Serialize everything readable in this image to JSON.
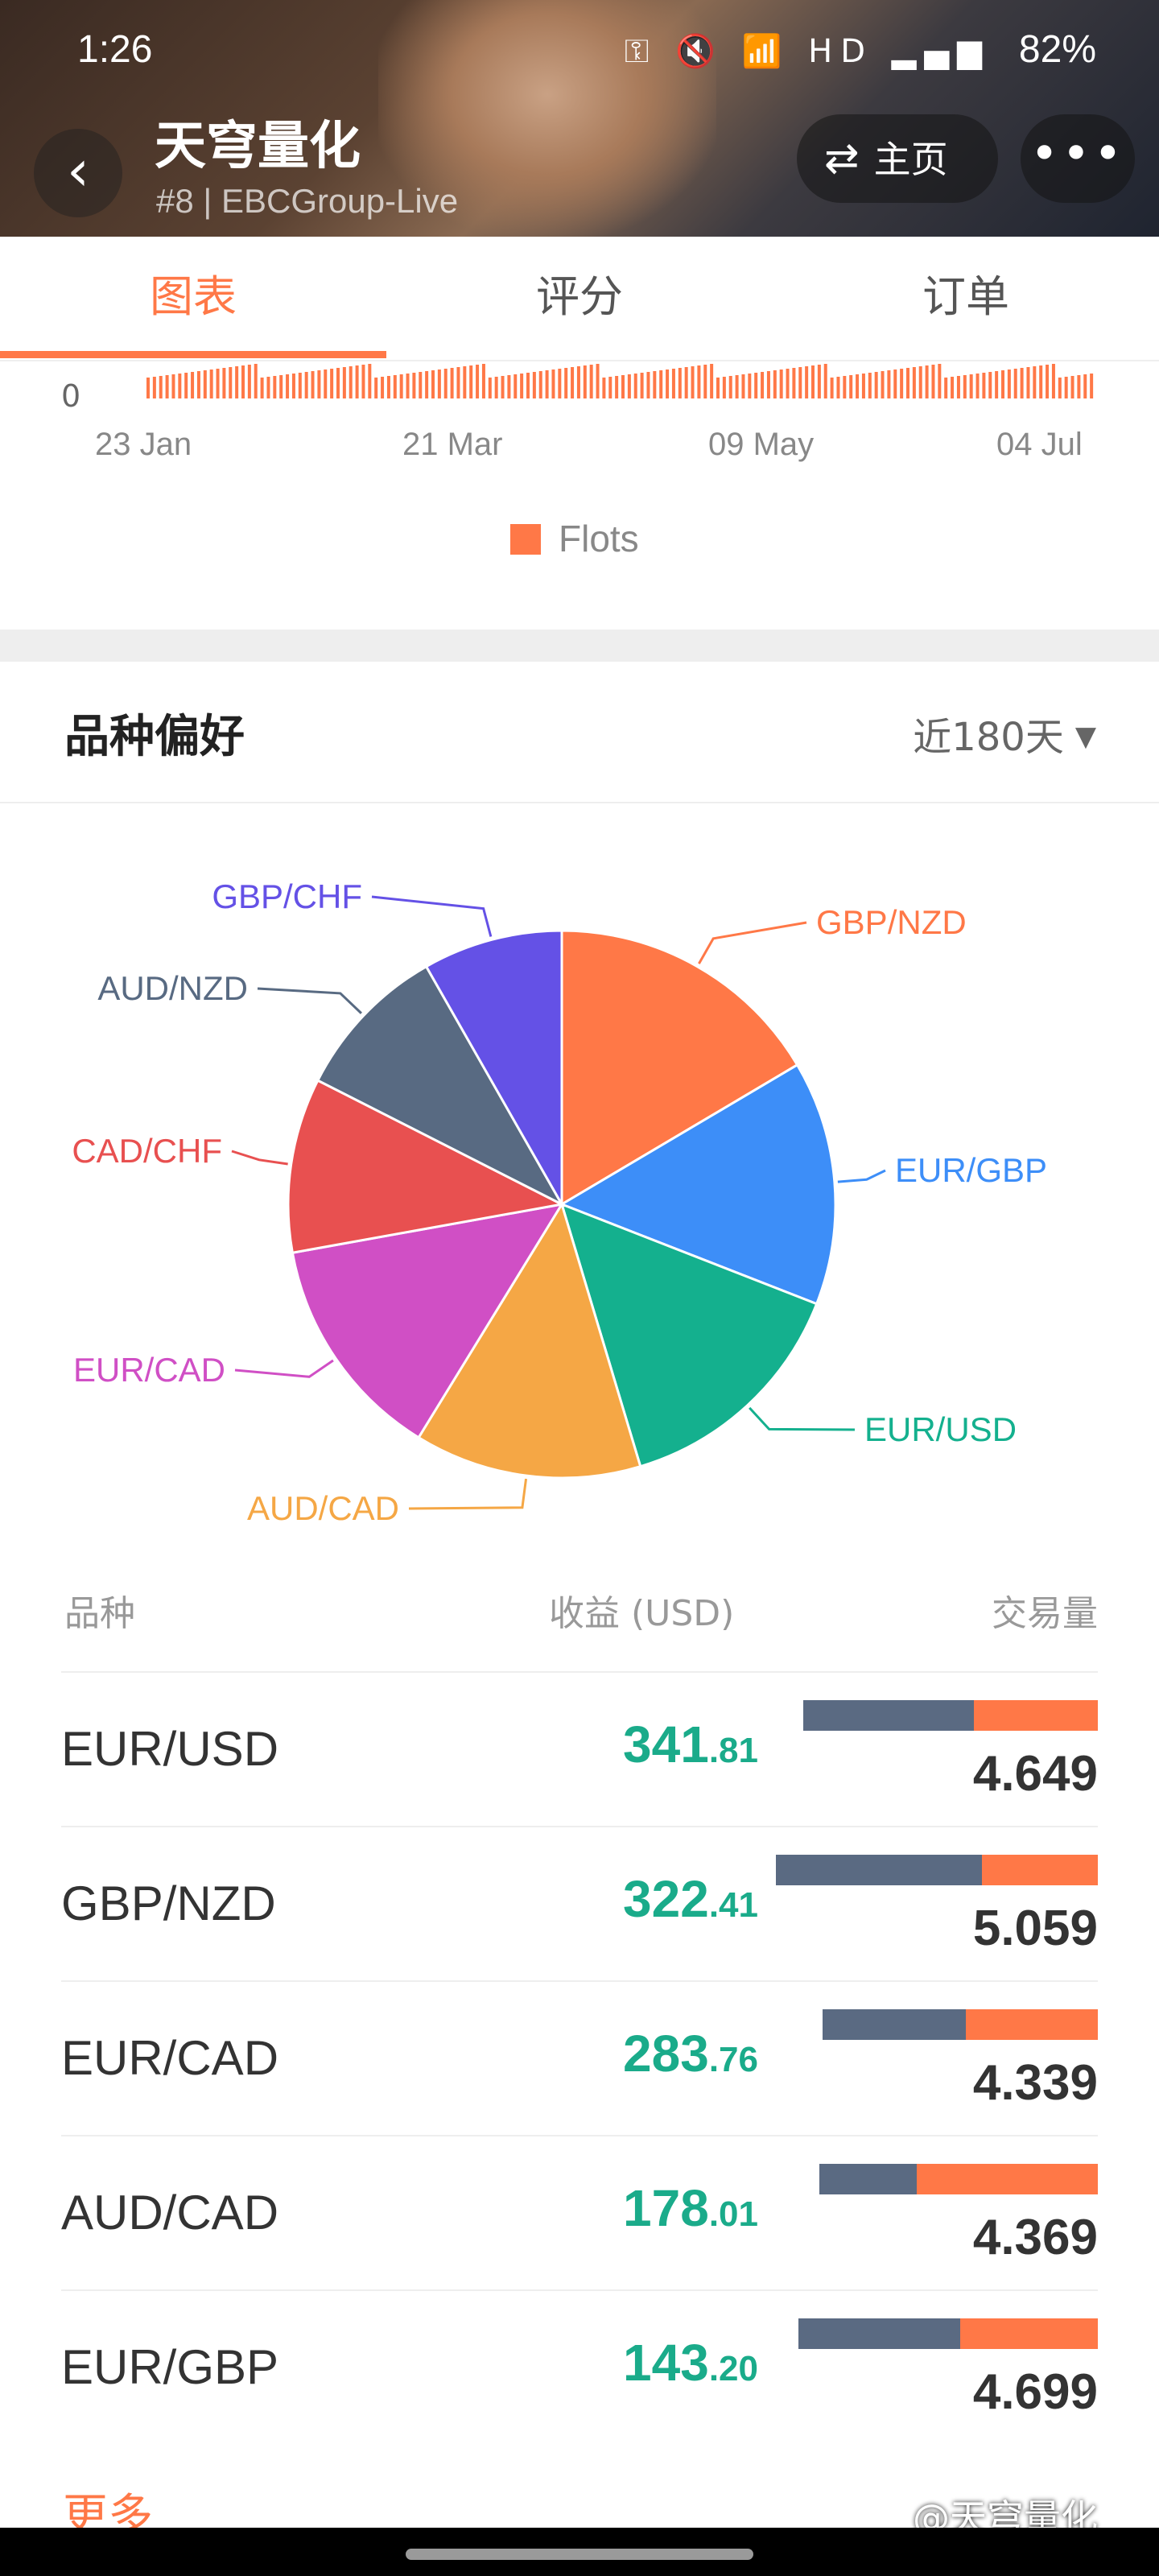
{
  "status_bar": {
    "time": "1:26",
    "battery": "82%",
    "icons": "⚿ 🔇 📶 HD ▂▄▆"
  },
  "header": {
    "title": "天穹量化",
    "subtitle": "#8 | EBCGroup-Live",
    "home_label": "主页",
    "back_icon": "chevron-left-icon",
    "more_icon": "more-dots-icon"
  },
  "tabs": [
    {
      "label": "图表",
      "active": true
    },
    {
      "label": "评分",
      "active": false
    },
    {
      "label": "订单",
      "active": false
    }
  ],
  "lots_chart": {
    "y_zero": "0",
    "x_ticks": [
      "23 Jan",
      "21 Mar",
      "09 May",
      "04 Jul"
    ],
    "legend": "Flots",
    "color": "#ff7847"
  },
  "preference": {
    "title": "品种偏好",
    "period": "近180天"
  },
  "chart_data": {
    "type": "pie",
    "labels": [
      "GBP/NZD",
      "EUR/GBP",
      "EUR/USD",
      "AUD/CAD",
      "EUR/CAD",
      "CAD/CHF",
      "AUD/NZD",
      "GBP/CHF"
    ],
    "values": [
      16.0,
      14.0,
      14.0,
      13.0,
      13.0,
      10.0,
      9.0,
      8.0
    ],
    "colors": [
      "#ff7847",
      "#3d8ef8",
      "#14b08e",
      "#f5a745",
      "#d04fc5",
      "#e85050",
      "#586a82",
      "#6451e6"
    ]
  },
  "table": {
    "headers": {
      "symbol": "品种",
      "profit": "收益 (USD)",
      "volume": "交易量"
    },
    "rows": [
      {
        "symbol": "EUR/USD",
        "profit_int": "341",
        "profit_dec": ".81",
        "volume": "4.649",
        "buy_fraction": 0.58
      },
      {
        "symbol": "GBP/NZD",
        "profit_int": "322",
        "profit_dec": ".41",
        "volume": "5.059",
        "buy_fraction": 0.64
      },
      {
        "symbol": "EUR/CAD",
        "profit_int": "283",
        "profit_dec": ".76",
        "volume": "4.339",
        "buy_fraction": 0.52
      },
      {
        "symbol": "AUD/CAD",
        "profit_int": "178",
        "profit_dec": ".01",
        "volume": "4.369",
        "buy_fraction": 0.35
      },
      {
        "symbol": "EUR/GBP",
        "profit_int": "143",
        "profit_dec": ".20",
        "volume": "4.699",
        "buy_fraction": 0.54
      }
    ]
  },
  "footer": {
    "more_label": "更多",
    "watermark": "@天穹量化"
  }
}
